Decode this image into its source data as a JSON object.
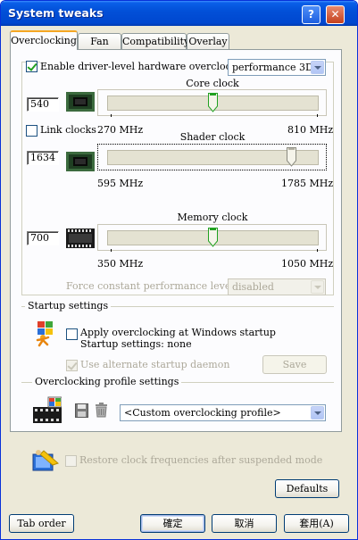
{
  "window": {
    "title": "System tweaks",
    "help_glyph": "?",
    "close_glyph": "✕"
  },
  "tabs": [
    "Overclocking",
    "Fan",
    "Compatibility",
    "Overlay"
  ],
  "overclock": {
    "enable_label": "Enable driver-level hardware overclocking",
    "enable_checked": true,
    "mode_value": "performance 3D",
    "link_clocks_label": "Link clocks",
    "link_clocks_checked": false
  },
  "core": {
    "title": "Core clock",
    "value": "540",
    "min_label": "270 MHz",
    "max_label": "810 MHz",
    "min": 270,
    "max": 810,
    "current": 540
  },
  "shader": {
    "title": "Shader clock",
    "value": "1634",
    "min_label": "595 MHz",
    "max_label": "1785 MHz",
    "min": 595,
    "max": 1785,
    "current": 1634
  },
  "memory": {
    "title": "Memory clock",
    "value": "700",
    "min_label": "350 MHz",
    "max_label": "1050 MHz",
    "min": 350,
    "max": 1050,
    "current": 700
  },
  "perf_level": {
    "label": "Force constant performance level",
    "value": "disabled"
  },
  "startup": {
    "group_title": "Startup settings",
    "apply_label": "Apply overclocking at Windows startup",
    "apply_checked": false,
    "status_text": "Startup settings: none",
    "daemon_label": "Use alternate startup daemon",
    "daemon_checked": true,
    "save_label": "Save"
  },
  "profile": {
    "group_title": "Overclocking profile settings",
    "profile_value": "<Custom overclocking profile>"
  },
  "restore": {
    "label": "Restore clock frequencies after suspended mode",
    "checked": false
  },
  "defaults_label": "Defaults",
  "footer": {
    "tab_order": "Tab order",
    "ok": "確定",
    "cancel": "取消",
    "apply": "套用(A)"
  },
  "colors": {
    "title_bar": "#0250d8",
    "dialog_bg": "#ece9d8",
    "panel_bg": "#fcfcfe",
    "thumb_green": "#21a121"
  }
}
